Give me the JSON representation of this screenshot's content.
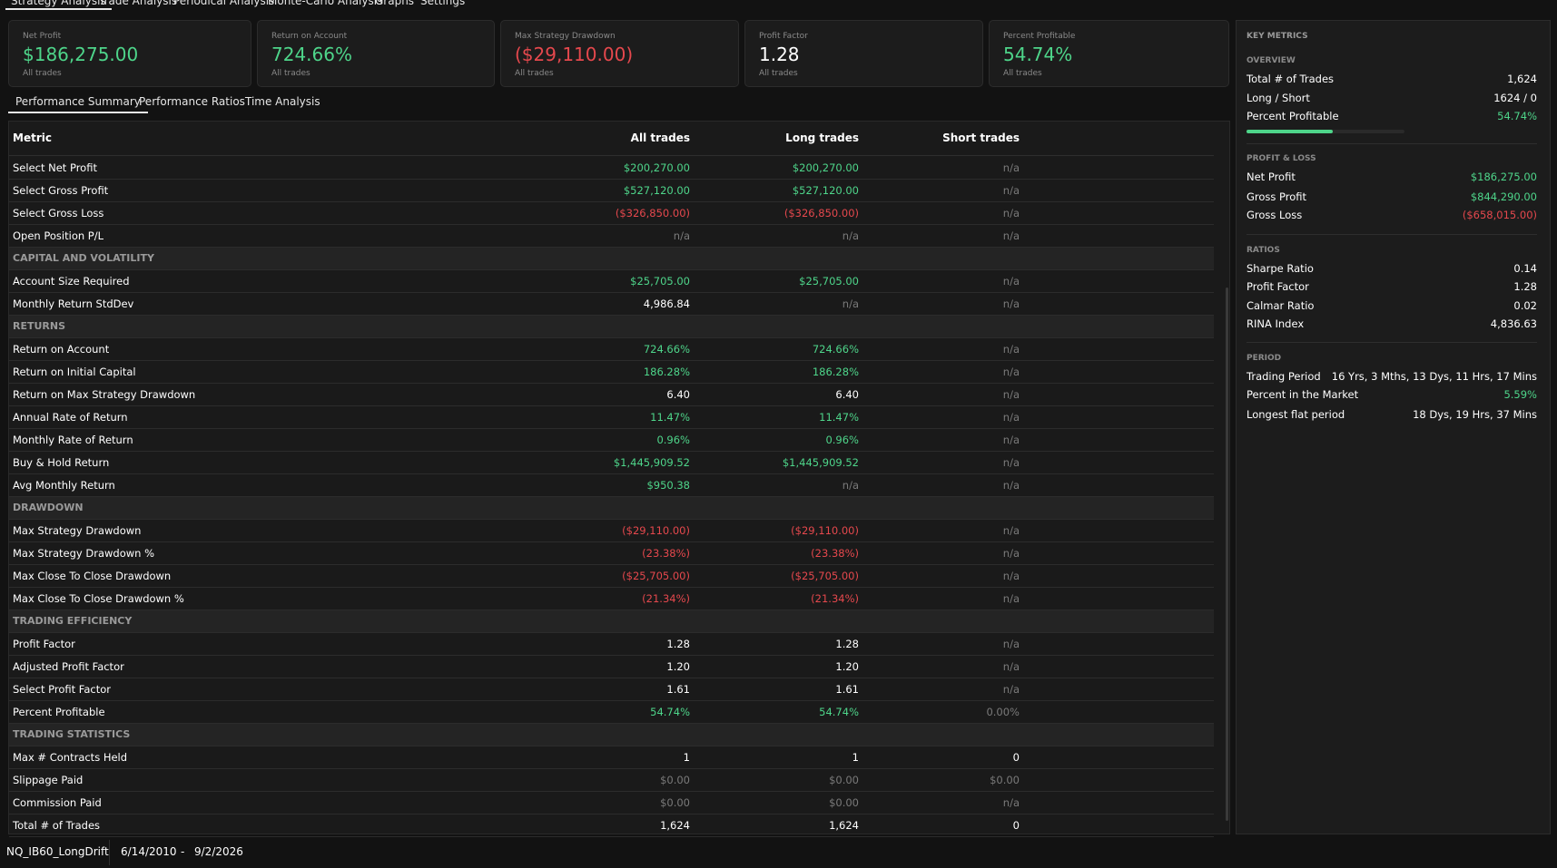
{
  "colors": {
    "positive": "#4ed58a",
    "negative": "#e5484d",
    "neutral": "#7a7a7a",
    "background": "#121212"
  },
  "topnav": {
    "tabs": [
      {
        "label": "Strategy Analysis",
        "active": true
      },
      {
        "label": "Trade Analysis"
      },
      {
        "label": "Periodical Analysis"
      },
      {
        "label": "Monte-Carlo Analysis"
      },
      {
        "label": "Graphs"
      },
      {
        "label": "Settings"
      }
    ]
  },
  "cards": [
    {
      "label": "Net Profit",
      "value": "$186,275.00",
      "sub": "All trades",
      "tone": "green"
    },
    {
      "label": "Return on Account",
      "value": "724.66%",
      "sub": "All trades",
      "tone": "green"
    },
    {
      "label": "Max Strategy Drawdown",
      "value": "($29,110.00)",
      "sub": "All trades",
      "tone": "red"
    },
    {
      "label": "Profit Factor",
      "value": "1.28",
      "sub": "All trades",
      "tone": "white"
    },
    {
      "label": "Percent Profitable",
      "value": "54.74%",
      "sub": "All trades",
      "tone": "green"
    }
  ],
  "subtabs": [
    {
      "label": "Performance Summary",
      "active": true
    },
    {
      "label": "Performance Ratios"
    },
    {
      "label": "Time Analysis"
    }
  ],
  "table": {
    "headers": [
      "Metric",
      "All trades",
      "Long trades",
      "Short trades"
    ],
    "rows": [
      {
        "cells": [
          "Select Net Profit",
          "$200,270.00",
          "$200,270.00",
          "n/a"
        ],
        "tones": [
          "",
          "green",
          "green",
          "grey"
        ]
      },
      {
        "cells": [
          "Select Gross Profit",
          "$527,120.00",
          "$527,120.00",
          "n/a"
        ],
        "tones": [
          "",
          "green",
          "green",
          "grey"
        ]
      },
      {
        "cells": [
          "Select Gross Loss",
          "($326,850.00)",
          "($326,850.00)",
          "n/a"
        ],
        "tones": [
          "",
          "red",
          "red",
          "grey"
        ]
      },
      {
        "cells": [
          "Open Position P/L",
          "n/a",
          "n/a",
          "n/a"
        ],
        "tones": [
          "",
          "grey",
          "grey",
          "grey"
        ]
      },
      {
        "section": true,
        "cells": [
          "CAPITAL AND VOLATILITY",
          "",
          "",
          ""
        ]
      },
      {
        "cells": [
          "Account Size Required",
          "$25,705.00",
          "$25,705.00",
          "n/a"
        ],
        "tones": [
          "",
          "green",
          "green",
          "grey"
        ]
      },
      {
        "cells": [
          "Monthly Return StdDev",
          "4,986.84",
          "n/a",
          "n/a"
        ],
        "tones": [
          "",
          "white",
          "grey",
          "grey"
        ]
      },
      {
        "section": true,
        "cells": [
          "RETURNS",
          "",
          "",
          ""
        ]
      },
      {
        "cells": [
          "Return on Account",
          "724.66%",
          "724.66%",
          "n/a"
        ],
        "tones": [
          "",
          "green",
          "green",
          "grey"
        ]
      },
      {
        "cells": [
          "Return on Initial Capital",
          "186.28%",
          "186.28%",
          "n/a"
        ],
        "tones": [
          "",
          "green",
          "green",
          "grey"
        ]
      },
      {
        "cells": [
          "Return on Max Strategy Drawdown",
          "6.40",
          "6.40",
          "n/a"
        ],
        "tones": [
          "",
          "white",
          "white",
          "grey"
        ]
      },
      {
        "cells": [
          "Annual Rate of Return",
          "11.47%",
          "11.47%",
          "n/a"
        ],
        "tones": [
          "",
          "green",
          "green",
          "grey"
        ]
      },
      {
        "cells": [
          "Monthly Rate of Return",
          "0.96%",
          "0.96%",
          "n/a"
        ],
        "tones": [
          "",
          "green",
          "green",
          "grey"
        ]
      },
      {
        "cells": [
          "Buy & Hold Return",
          "$1,445,909.52",
          "$1,445,909.52",
          "n/a"
        ],
        "tones": [
          "",
          "green",
          "green",
          "grey"
        ]
      },
      {
        "cells": [
          "Avg Monthly Return",
          "$950.38",
          "n/a",
          "n/a"
        ],
        "tones": [
          "",
          "green",
          "grey",
          "grey"
        ]
      },
      {
        "section": true,
        "cells": [
          "DRAWDOWN",
          "",
          "",
          ""
        ]
      },
      {
        "cells": [
          "Max Strategy Drawdown",
          "($29,110.00)",
          "($29,110.00)",
          "n/a"
        ],
        "tones": [
          "",
          "red",
          "red",
          "grey"
        ]
      },
      {
        "cells": [
          "Max Strategy Drawdown %",
          "(23.38%)",
          "(23.38%)",
          "n/a"
        ],
        "tones": [
          "",
          "red",
          "red",
          "grey"
        ]
      },
      {
        "cells": [
          "Max Close To Close Drawdown",
          "($25,705.00)",
          "($25,705.00)",
          "n/a"
        ],
        "tones": [
          "",
          "red",
          "red",
          "grey"
        ]
      },
      {
        "cells": [
          "Max Close To Close Drawdown %",
          "(21.34%)",
          "(21.34%)",
          "n/a"
        ],
        "tones": [
          "",
          "red",
          "red",
          "grey"
        ]
      },
      {
        "section": true,
        "cells": [
          "TRADING EFFICIENCY",
          "",
          "",
          ""
        ]
      },
      {
        "cells": [
          "Profit Factor",
          "1.28",
          "1.28",
          "n/a"
        ],
        "tones": [
          "",
          "white",
          "white",
          "grey"
        ]
      },
      {
        "cells": [
          "Adjusted Profit Factor",
          "1.20",
          "1.20",
          "n/a"
        ],
        "tones": [
          "",
          "white",
          "white",
          "grey"
        ]
      },
      {
        "cells": [
          "Select Profit Factor",
          "1.61",
          "1.61",
          "n/a"
        ],
        "tones": [
          "",
          "white",
          "white",
          "grey"
        ]
      },
      {
        "cells": [
          "Percent Profitable",
          "54.74%",
          "54.74%",
          "0.00%"
        ],
        "tones": [
          "",
          "green",
          "green",
          "grey"
        ]
      },
      {
        "section": true,
        "cells": [
          "TRADING STATISTICS",
          "",
          "",
          ""
        ]
      },
      {
        "cells": [
          "Max # Contracts Held",
          "1",
          "1",
          "0"
        ],
        "tones": [
          "",
          "white",
          "white",
          "white"
        ]
      },
      {
        "cells": [
          "Slippage Paid",
          "$0.00",
          "$0.00",
          "$0.00"
        ],
        "tones": [
          "",
          "grey",
          "grey",
          "grey"
        ]
      },
      {
        "cells": [
          "Commission Paid",
          "$0.00",
          "$0.00",
          "n/a"
        ],
        "tones": [
          "",
          "grey",
          "grey",
          "grey"
        ]
      },
      {
        "cells": [
          "Total # of Trades",
          "1,624",
          "1,624",
          "0"
        ],
        "tones": [
          "",
          "white",
          "white",
          "white"
        ]
      }
    ]
  },
  "side": {
    "title": "KEY METRICS",
    "sections": [
      {
        "title": "OVERVIEW",
        "rows": [
          {
            "k": "Total # of Trades",
            "v": "1,624",
            "tone": "white"
          },
          {
            "k": "Long / Short",
            "v": "1624 / 0",
            "tone": "white"
          },
          {
            "k": "Percent Profitable",
            "v": "54.74%",
            "tone": "green"
          }
        ],
        "progress": 0.5474
      },
      {
        "title": "PROFIT & LOSS",
        "rows": [
          {
            "k": "Net Profit",
            "v": "$186,275.00",
            "tone": "green"
          },
          {
            "k": "Gross Profit",
            "v": "$844,290.00",
            "tone": "green"
          },
          {
            "k": "Gross Loss",
            "v": "($658,015.00)",
            "tone": "red"
          }
        ]
      },
      {
        "title": "RATIOS",
        "rows": [
          {
            "k": "Sharpe Ratio",
            "v": "0.14",
            "tone": "white"
          },
          {
            "k": "Profit Factor",
            "v": "1.28",
            "tone": "white"
          },
          {
            "k": "Calmar Ratio",
            "v": "0.02",
            "tone": "white"
          },
          {
            "k": "RINA Index",
            "v": "4,836.63",
            "tone": "white"
          }
        ]
      },
      {
        "title": "PERIOD",
        "rows": [
          {
            "k": "Trading Period",
            "v": "16 Yrs, 3 Mths, 13 Dys, 11 Hrs, 17 Mins",
            "tone": "white"
          },
          {
            "k": "Percent in the Market",
            "v": "5.59%",
            "tone": "green"
          },
          {
            "k": "Longest flat period",
            "v": "18 Dys, 19 Hrs, 37 Mins",
            "tone": "white"
          }
        ]
      }
    ]
  },
  "status": {
    "strategy": "NQ_IB60_LongDrift",
    "date_from": "6/14/2010",
    "date_sep": "-",
    "date_to": "9/2/2026"
  }
}
